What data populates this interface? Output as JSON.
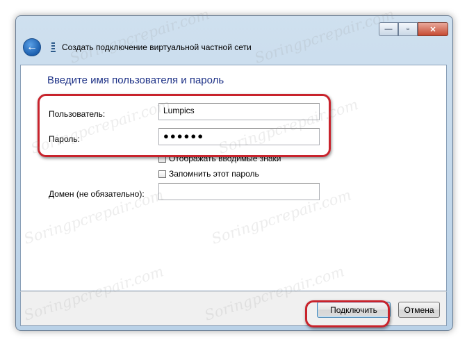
{
  "window": {
    "title": "Создать подключение виртуальной частной сети",
    "min_label": "—",
    "max_label": "▫",
    "close_label": "✕",
    "back_label": "←"
  },
  "form": {
    "heading": "Введите имя пользователя и пароль",
    "user_label": "Пользователь:",
    "user_value": "Lumpics",
    "password_label": "Пароль:",
    "password_value": "●●●●●●",
    "show_chars_label": "Отображать вводимые знаки",
    "show_chars_checked": false,
    "remember_label": "Запомнить этот пароль",
    "remember_checked": false,
    "domain_label": "Домен (не обязательно):",
    "domain_value": ""
  },
  "footer": {
    "connect_label": "Подключить",
    "cancel_label": "Отмена"
  },
  "watermark": "Soringpcrepair.com",
  "colors": {
    "heading": "#1e3287",
    "highlight": "#c8232c"
  }
}
